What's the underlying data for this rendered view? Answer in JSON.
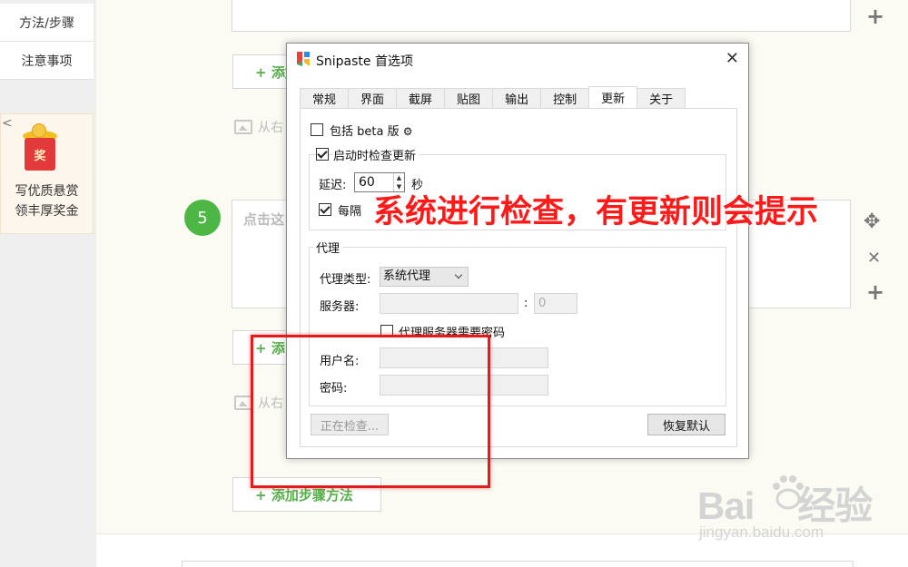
{
  "sidebar": {
    "items": [
      {
        "label": "方法/步骤"
      },
      {
        "label": "注意事项"
      }
    ],
    "reward": {
      "collapse_glyph": "<",
      "badge_char": "奖",
      "line1": "写优质悬赏",
      "line2": "领丰厚奖金"
    }
  },
  "editor": {
    "add_step_label": "添加步骤方法",
    "add_partial_1": "添加",
    "add_partial_2": "添",
    "image_hint_1": "从右",
    "image_hint_2": "从右",
    "step_number": "5",
    "textbox_placeholder": "点击这",
    "plus_glyph": "+"
  },
  "dialog": {
    "title": "Snipaste 首选项",
    "close_glyph": "✕",
    "tabs": [
      "常规",
      "界面",
      "截屏",
      "贴图",
      "输出",
      "控制",
      "更新",
      "关于"
    ],
    "active_tab": "更新",
    "include_beta_label": "包括 beta 版",
    "check_on_start_label": "启动时检查更新",
    "delay_label": "延迟:",
    "delay_value": "60",
    "delay_unit": "秒",
    "every_label": "每隔",
    "proxy_group_title": "代理",
    "proxy_type_label": "代理类型:",
    "proxy_type_value": "系统代理",
    "server_label": "服务器:",
    "server_value": "",
    "port_sep": ":",
    "port_value": "0",
    "proxy_auth_label": "代理服务器需要密码",
    "username_label": "用户名:",
    "password_label": "密码:",
    "checking_button": "正在检查...",
    "restore_button": "恢复默认"
  },
  "annotation": {
    "text": "系统进行检查，有更新则会提示",
    "color": "#ff1a1a"
  },
  "watermark": {
    "brand": "Bai",
    "brand_tail": "经验",
    "url": "jingyan.baidu.com"
  },
  "colors": {
    "accent_green": "#55b04a",
    "step_green": "#4cb744",
    "highlight_red": "#e01c1c"
  }
}
